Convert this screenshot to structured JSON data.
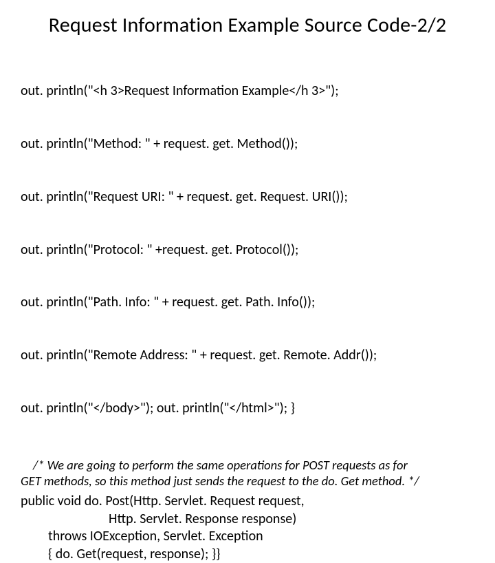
{
  "title": "Request Information Example Source Code-2/2",
  "code": {
    "l1": "out. println(\"<h 3>Request Information Example</h 3>\");",
    "l2": "out. println(\"Method: \" + request. get. Method());",
    "l3": "out. println(\"Request URI: \" + request. get. Request. URI());",
    "l4": "out. println(\"Protocol: \" +request. get. Protocol());",
    "l5": "out. println(\"Path. Info: \" + request. get. Path. Info());",
    "l6": "out. println(\"Remote Address: \" + request. get. Remote. Addr());",
    "l7": "out. println(\"</body>\"); out. println(\"</html>\"); }"
  },
  "comment": {
    "l1": "/* We are going to perform the same operations for POST requests as for",
    "l2": "GET methods, so this method just sends the request to the do. Get method. */"
  },
  "method": {
    "l1": "public void do. Post(Http. Servlet. Request request,",
    "l2": "Http. Servlet. Response response)",
    "l3": "throws IOException, Servlet. Exception",
    "l4": "{ do. Get(request, response); }}"
  }
}
